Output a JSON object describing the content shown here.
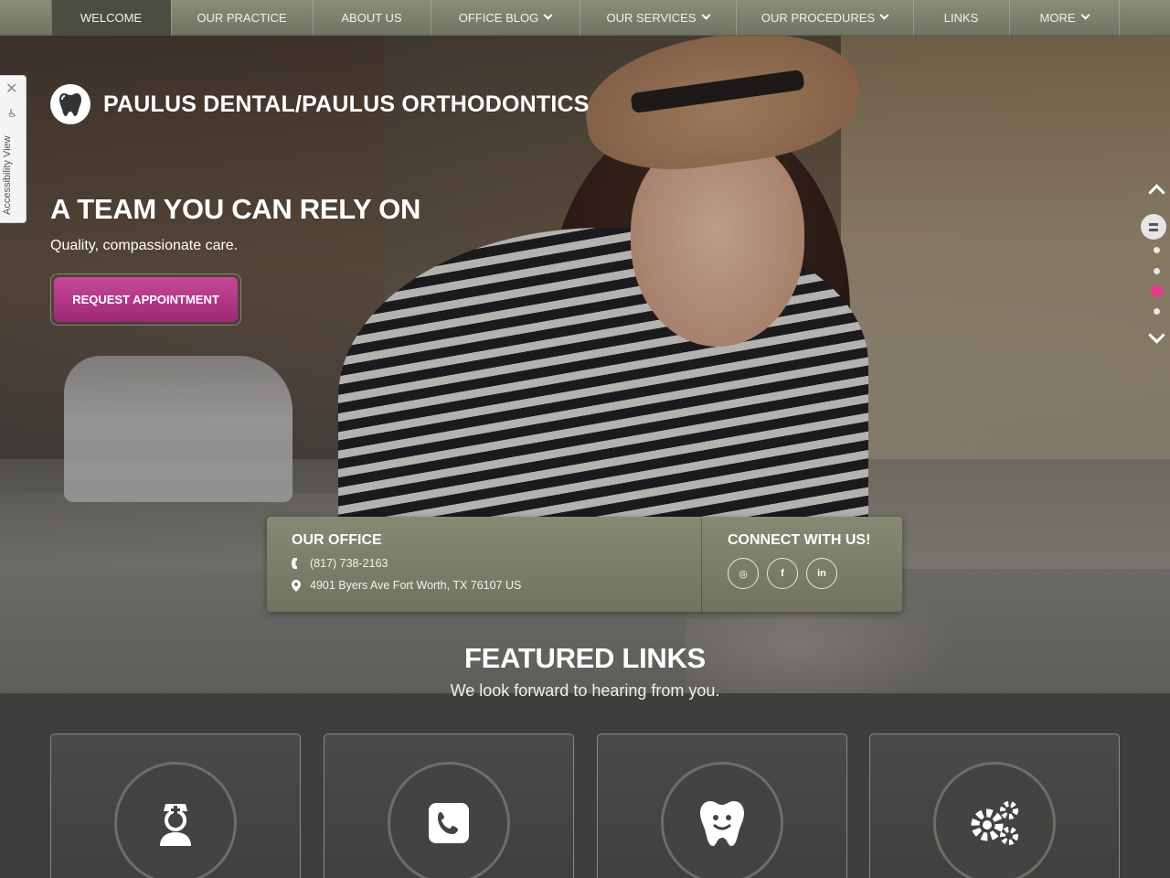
{
  "nav": {
    "items": [
      {
        "label": "WELCOME",
        "dropdown": false,
        "active": true
      },
      {
        "label": "OUR PRACTICE",
        "dropdown": false
      },
      {
        "label": "ABOUT US",
        "dropdown": false
      },
      {
        "label": "OFFICE BLOG",
        "dropdown": true
      },
      {
        "label": "OUR SERVICES",
        "dropdown": true
      },
      {
        "label": "OUR PROCEDURES",
        "dropdown": true
      },
      {
        "label": "LINKS",
        "dropdown": false
      },
      {
        "label": "MORE",
        "dropdown": true
      }
    ]
  },
  "accessibility": {
    "label": "Accessibility View",
    "close_icon": "close-icon",
    "person_icon": "accessibility-icon"
  },
  "brand": {
    "name": "PAULUS DENTAL/PAULUS ORTHODONTICS",
    "logo_icon": "tooth-icon"
  },
  "hero": {
    "title": "A TEAM YOU CAN RELY ON",
    "subtitle": "Quality, compassionate care.",
    "cta_label": "REQUEST APPOINTMENT",
    "cta_color": "#b23a86",
    "slides": {
      "count": 4,
      "active_index": 2
    }
  },
  "office": {
    "heading": "OUR OFFICE",
    "phone": "(817) 738-2163",
    "address": "4901 Byers Ave Fort Worth, TX 76107 US"
  },
  "connect": {
    "heading": "CONNECT WITH US!",
    "socials": [
      {
        "name": "instagram-icon",
        "glyph": "◎"
      },
      {
        "name": "facebook-icon",
        "glyph": "f"
      },
      {
        "name": "linkedin-icon",
        "glyph": "in"
      }
    ]
  },
  "featured": {
    "title": "FEATURED LINKS",
    "subtitle": "We look forward to hearing from you.",
    "cards": [
      {
        "icon": "nurse-icon"
      },
      {
        "icon": "phone-icon"
      },
      {
        "icon": "tooth-icon"
      },
      {
        "icon": "gears-icon"
      }
    ]
  },
  "colors": {
    "nav_bg": "#7b8069",
    "accent_pink": "#e5398c",
    "card_bg": "#7a7f6a"
  }
}
